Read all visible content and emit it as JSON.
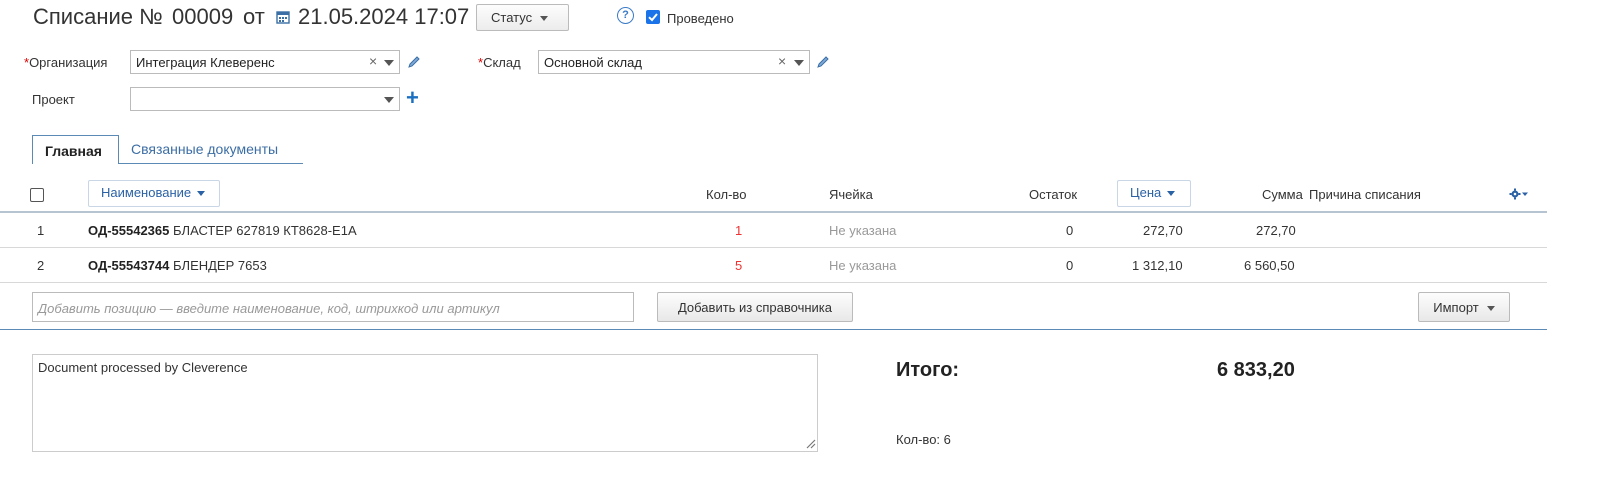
{
  "header": {
    "title": "Списание №",
    "number": "00009",
    "date_prefix": "от",
    "date": "21.05.2024 17:07",
    "status_label": "Статус",
    "help_label": "?",
    "posted_label": "Проведено",
    "posted_checked": true
  },
  "fields": {
    "organization": {
      "label": "Организация",
      "required_mark": "*",
      "value": "Интеграция Клеверенс",
      "clear": "×"
    },
    "warehouse": {
      "label": "Склад",
      "required_mark": "*",
      "value": "Основной склад",
      "clear": "×"
    },
    "project": {
      "label": "Проект",
      "value": "",
      "add": "+"
    }
  },
  "tabs": [
    {
      "label": "Главная",
      "active": true
    },
    {
      "label": "Связанные документы",
      "active": false
    }
  ],
  "table": {
    "headers": {
      "name": "Наименование",
      "qty": "Кол-во",
      "cell": "Ячейка",
      "stock": "Остаток",
      "price": "Цена",
      "sum": "Сумма",
      "reason": "Причина списания"
    },
    "rows": [
      {
        "n": "1",
        "code": "ОД-55542365",
        "name": "БЛАСТЕР 627819 КТ8628-E1A",
        "qty": "1",
        "cell": "Не указана",
        "stock": "0",
        "price": "272,70",
        "sum": "272,70",
        "reason": ""
      },
      {
        "n": "2",
        "code": "ОД-55543744",
        "name": "БЛЕНДЕР 7653",
        "qty": "5",
        "cell": "Не указана",
        "stock": "0",
        "price": "1 312,10",
        "sum": "6 560,50",
        "reason": ""
      }
    ]
  },
  "add_row": {
    "placeholder": "Добавить позицию — введите наименование, код, штрихкод или артикул",
    "from_catalog_label": "Добавить из справочника",
    "import_label": "Импорт"
  },
  "comment": "Document processed by Cleverence",
  "totals": {
    "label": "Итого:",
    "value": "6 833,20",
    "qty_label": "Кол-во: 6"
  },
  "colors": {
    "accent": "#2b62a5",
    "qty_red": "#e33",
    "checkbox": "#1a73e8"
  }
}
